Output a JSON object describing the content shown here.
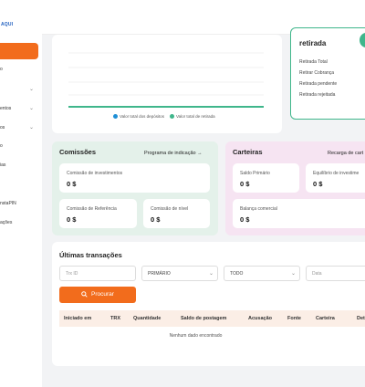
{
  "brand": {
    "logo_text": "AQUI",
    "accent": "#f26c1c",
    "green": "#3fb68b"
  },
  "sidebar": {
    "items": [
      {
        "label": "",
        "active": true
      },
      {
        "label": "o",
        "has_chevron": false
      },
      {
        "label": "",
        "has_chevron": true
      },
      {
        "label": "entos",
        "has_chevron": true
      },
      {
        "label": "os",
        "has_chevron": true
      },
      {
        "label": "o",
        "has_chevron": false
      },
      {
        "label": "ias",
        "has_chevron": false
      },
      {
        "label": "",
        "has_chevron": false
      },
      {
        "label": "nstaPIN",
        "has_chevron": false
      },
      {
        "label": "ações",
        "has_chevron": false
      }
    ]
  },
  "chart": {
    "legend": [
      {
        "label": "Valor total dos depósitos",
        "color": "#1f8fd6"
      },
      {
        "label": "Valor total de retirada",
        "color": "#3fb68b"
      }
    ]
  },
  "withdraw": {
    "title": "retirada",
    "items": [
      "Retirada Total",
      "Retirar Cobrança",
      "Retirada pendente",
      "Retirada rejeitada"
    ]
  },
  "commissions": {
    "title": "Comissões",
    "link": "Programa de indicação →",
    "cards": [
      {
        "label": "Comissão de investimentos",
        "value": "0 $"
      },
      {
        "label": "Comissão de Referência",
        "value": "0 $"
      },
      {
        "label": "Comissão de nível",
        "value": "0 $"
      }
    ]
  },
  "wallets": {
    "title": "Carteiras",
    "link": "Recarga de cart",
    "cards": [
      {
        "label": "Saldo Primário",
        "value": "0 $"
      },
      {
        "label": "Equilíbrio de investime",
        "value": "0 $"
      },
      {
        "label": "Balança comercial",
        "value": "0 $"
      }
    ]
  },
  "transactions": {
    "title": "Últimas transações",
    "filters": {
      "trx_placeholder": "Trx ID",
      "type_value": "PRIMÁRIO",
      "status_value": "TODO",
      "date_placeholder": "Data"
    },
    "search_label": "Procurar",
    "columns": [
      "Iniciado em",
      "TRX",
      "Quantidade",
      "Saldo de postagem",
      "Acusação",
      "Fonte",
      "Carteira",
      "Det"
    ],
    "empty_text": "Nenhum dado encontrado"
  }
}
